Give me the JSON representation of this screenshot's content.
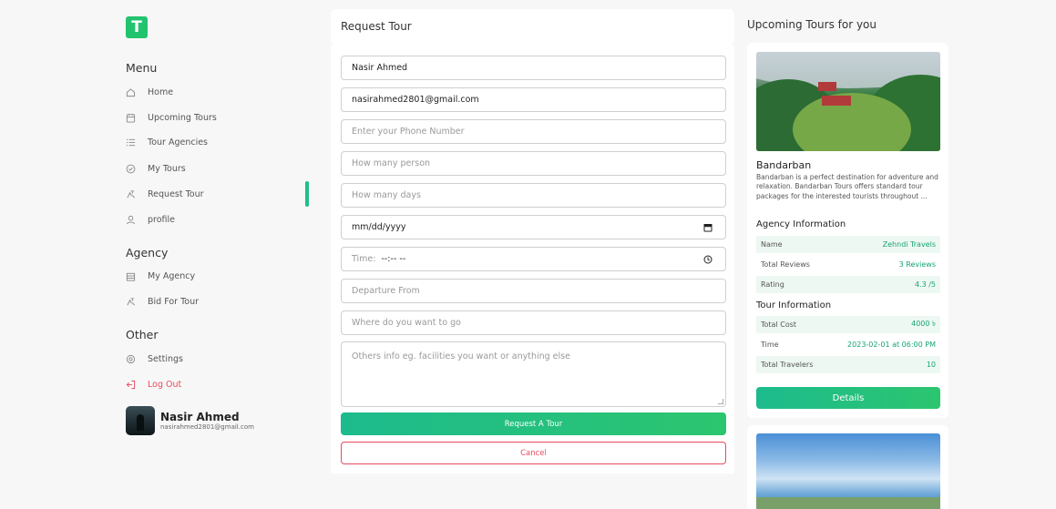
{
  "logo": {
    "letter": "T"
  },
  "sidebar": {
    "menu_title": "Menu",
    "menu_items": [
      {
        "label": "Home",
        "icon": "home-icon"
      },
      {
        "label": "Upcoming Tours",
        "icon": "calendar-icon"
      },
      {
        "label": "Tour Agencies",
        "icon": "list-icon"
      },
      {
        "label": "My Tours",
        "icon": "check-circle-icon"
      },
      {
        "label": "Request Tour",
        "icon": "travel-icon",
        "active": true
      },
      {
        "label": "profile",
        "icon": "user-icon"
      }
    ],
    "agency_title": "Agency",
    "agency_items": [
      {
        "label": "My Agency",
        "icon": "building-icon"
      },
      {
        "label": "Bid For Tour",
        "icon": "travel-icon"
      }
    ],
    "other_title": "Other",
    "other_items": [
      {
        "label": "Settings",
        "icon": "gear-icon"
      },
      {
        "label": "Log Out",
        "icon": "logout-icon"
      }
    ],
    "user": {
      "name": "Nasir Ahmed",
      "email": "nasirahmed2801@gmail.com"
    }
  },
  "form": {
    "title": "Request Tour",
    "name_value": "Nasir Ahmed",
    "email_value": "nasirahmed2801@gmail.com",
    "phone_placeholder": "Enter your Phone Number",
    "persons_placeholder": "How many person",
    "days_placeholder": "How many days",
    "date_value": "mm/dd/yyyy",
    "time_label": "Time:",
    "time_value": "--:-- --",
    "departure_placeholder": "Departure From",
    "destination_placeholder": "Where do you want to go",
    "others_placeholder": "Others info eg. facilities you want or anything else",
    "submit_label": "Request A Tour",
    "cancel_label": "Cancel"
  },
  "upcoming": {
    "title": "Upcoming Tours for you",
    "tours": [
      {
        "name": "Bandarban",
        "description": "Bandarban is a perfect destination for adventure and relaxation. Bandarban Tours offers standard tour packages for the interested tourists throughout ...",
        "agency_title": "Agency Information",
        "agency": [
          {
            "key": "Name",
            "value": "Zehndi Travels"
          },
          {
            "key": "Total Reviews",
            "value": "3 Reviews"
          },
          {
            "key": "Rating",
            "value": "4.3 /5"
          }
        ],
        "tour_title": "Tour Information",
        "tour": [
          {
            "key": "Total Cost",
            "value": "4000 ৳"
          },
          {
            "key": "Time",
            "value": "2023-02-01 at 06:00 PM"
          },
          {
            "key": "Total Travelers",
            "value": "10"
          }
        ],
        "details_label": "Details"
      }
    ]
  },
  "colors": {
    "accent": "#1ebf8a",
    "danger": "#e84a5f",
    "logo": "#22c36f"
  }
}
